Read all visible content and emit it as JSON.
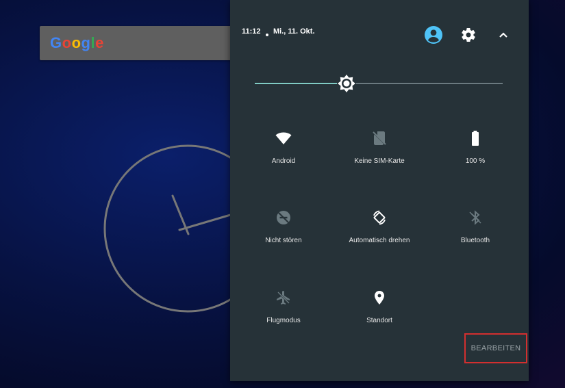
{
  "wallpaper": {
    "google_logo": [
      "G",
      "o",
      "o",
      "g",
      "l",
      "e"
    ]
  },
  "status_bar": {
    "time": "11:12",
    "date": "Mi., 11. Okt.",
    "user_icon": "account-circle-icon",
    "settings_icon": "gear-icon",
    "collapse_icon": "chevron-up-icon"
  },
  "brightness": {
    "level": 0.37,
    "icon": "brightness-icon",
    "accent": "#80cbc4"
  },
  "tiles": [
    {
      "label": "Android",
      "icon": "wifi-icon",
      "active": true
    },
    {
      "label": "Keine SIM-Karte",
      "icon": "no-sim-icon",
      "active": false
    },
    {
      "label": "100 %",
      "icon": "battery-icon",
      "active": true
    },
    {
      "label": "Nicht stören",
      "icon": "do-not-disturb-icon",
      "active": false
    },
    {
      "label": "Automatisch drehen",
      "icon": "auto-rotate-icon",
      "active": true
    },
    {
      "label": "Bluetooth",
      "icon": "bluetooth-icon",
      "active": false
    },
    {
      "label": "Flugmodus",
      "icon": "airplane-icon",
      "active": false
    },
    {
      "label": "Standort",
      "icon": "location-icon",
      "active": true
    }
  ],
  "edit_button": {
    "label": "BEARBEITEN",
    "highlight_color": "#d32f2f"
  }
}
